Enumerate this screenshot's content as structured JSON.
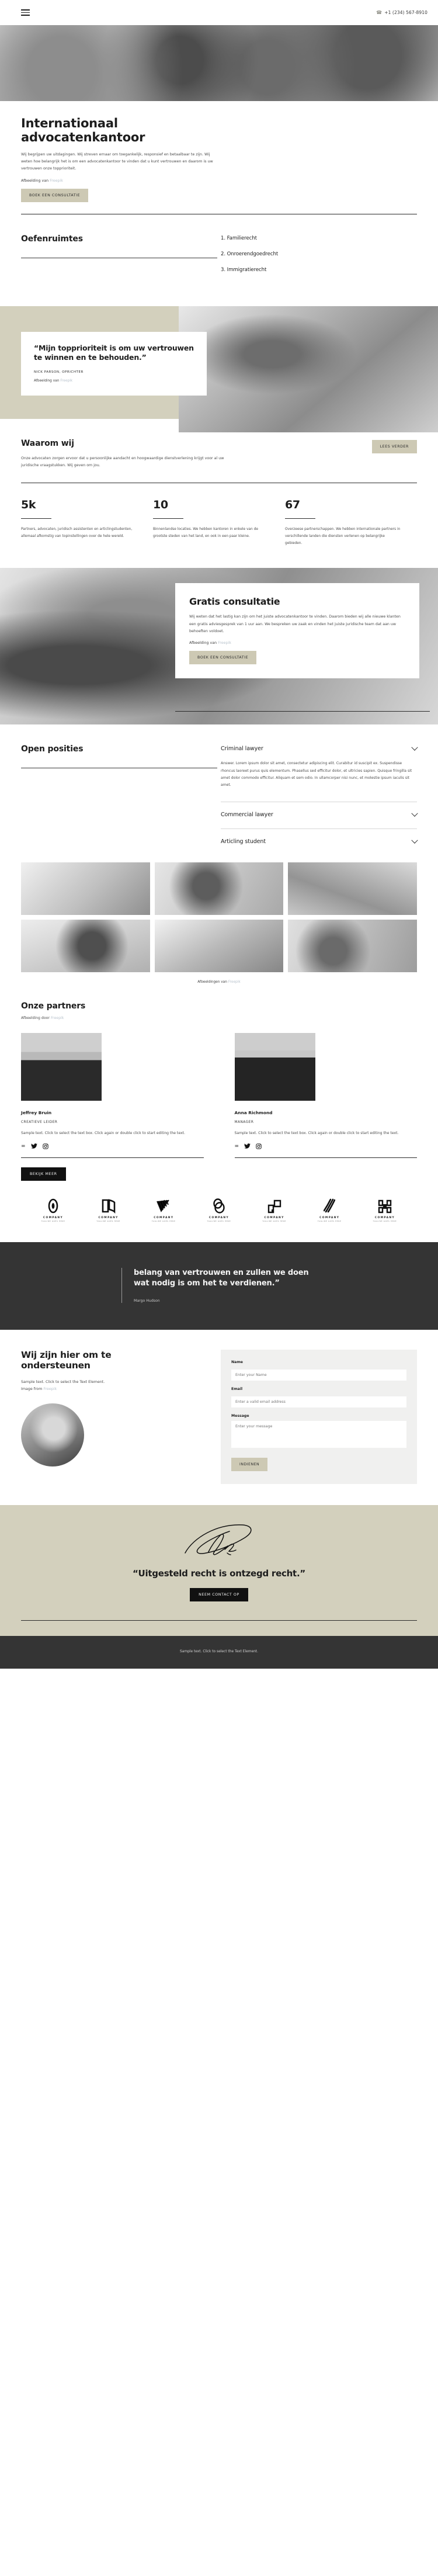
{
  "topbar": {
    "menu_icon": "hamburger-menu-icon",
    "phone_icon": "phone-icon",
    "phone": "+1 (234) 567-8910"
  },
  "hero": {
    "title_line1": "Internationaal",
    "title_line2": "advocatenkantoor",
    "paragraph": "Wij begrijpen uw uitdagingen. Wij streven ernaar om toegankelijk, responsief en betaalbaar te zijn. Wij weten hoe belangrijk het is om een advocatenkantoor te vinden dat u kunt vertrouwen en daarom is uw vertrouwen onze topprioriteit.",
    "credit_prefix": "Afbeelding van",
    "credit_link": "Freepik",
    "cta": "BOEK EEN CONSULTATIE"
  },
  "practice": {
    "title": "Oefenruimtes",
    "items": [
      "1. Familierecht",
      "2. Onroerendgoedrecht",
      "3. Immigratierecht"
    ]
  },
  "testimonial": {
    "quote": "“Mijn topprioriteit is om uw vertrouwen te winnen en te behouden.”",
    "author": "NICK PARSON, OPRICHTER",
    "credit_prefix": "Afbeelding van",
    "credit_link": "Freepik"
  },
  "why": {
    "title": "Waarom wij",
    "paragraph": "Onze advocaten zorgen ervoor dat u persoonlijke aandacht en hoogwaardige dienstverlening krijgt voor al uw juridische vraagstukken. Wij geven om jou.",
    "cta": "LEES VERDER",
    "stats": [
      {
        "number": "5k",
        "text": "Partners, advocaten, juridisch assistenten en articlingstudenten, allemaal afkomstig van topinstellingen over de hele wereld."
      },
      {
        "number": "10",
        "text": "Binnenlandse locaties. We hebben kantoren in enkele van de grootste steden van het land, en ook in een paar kleine."
      },
      {
        "number": "67",
        "text": "Overzeese partnerschappen. We hebben internationale partners in verschillende landen die diensten verlenen op belangrijke gebieden."
      }
    ]
  },
  "consult": {
    "title": "Gratis consultatie",
    "paragraph": "Wij weten dat het lastig kan zijn om het juiste advocatenkantoor te vinden. Daarom bieden wij alle nieuwe klanten een gratis adviesgesprek van 1 uur aan. We bespreken uw zaak en vinden het juiste juridische team dat aan uw behoeften voldoet.",
    "credit_prefix": "Afbeelding van",
    "credit_link": "Freepik",
    "cta": "BOEK EEN CONSULTATIE"
  },
  "positions": {
    "title": "Open posities",
    "accordion": [
      {
        "label": "Criminal lawyer",
        "body": "Answer. Lorem ipsum dolor sit amet, consectetur adipiscing elit. Curabitur id suscipit ex. Suspendisse rhoncus laoreet purus quis elementum. Phasellus sed efficitur dolor, et ultricies sapien. Quisque fringilla sit amet dolor commodo efficitur. Aliquam et sem odio. In ullamcorper nisi nunc, et molestie ipsum iaculis sit amet.",
        "expanded": true
      },
      {
        "label": "Commercial lawyer",
        "body": "",
        "expanded": false
      },
      {
        "label": "Articling student",
        "body": "",
        "expanded": false
      }
    ]
  },
  "gallery": {
    "credit_prefix": "Afbeeldingen van",
    "credit_link": "Freepik"
  },
  "partners": {
    "title": "Onze partners",
    "subtitle_prefix": "Afbeelding door",
    "subtitle_link": "Freepik",
    "people": [
      {
        "name": "Jeffrey Bruin",
        "role": "CREATIEVE LEIDER",
        "bio": "Sample text. Click to select the text box. Click again or double click to start editing the text.",
        "socials": [
          "facebook-icon",
          "twitter-icon",
          "instagram-icon"
        ]
      },
      {
        "name": "Anna Richmond",
        "role": "MANAGER",
        "bio": "Sample text. Click to select the text box. Click again or double click to start editing the text.",
        "socials": [
          "facebook-icon",
          "twitter-icon",
          "instagram-icon"
        ]
      }
    ],
    "cta": "BEKIJK MEER"
  },
  "logos": [
    {
      "name": "COMPANY",
      "tagline": "TAGLINE GOES HERE"
    },
    {
      "name": "COMPANY",
      "tagline": "TAGLINE GOES HERE"
    },
    {
      "name": "COMPANY",
      "tagline": "TAGLINE GOES HERE"
    },
    {
      "name": "COMPANY",
      "tagline": "TAGLINE GOES HERE"
    },
    {
      "name": "COMPANY",
      "tagline": "TAGLINE GOES HERE"
    },
    {
      "name": "COMPANY",
      "tagline": "TAGLINE GOES HERE"
    },
    {
      "name": "COMPANY",
      "tagline": "TAGLINE GOES HERE"
    }
  ],
  "dark_quote": {
    "quote": "belang van vertrouwen en zullen we doen wat nodig is om het te verdienen.”",
    "author": "Margo Hudson"
  },
  "contact": {
    "title_line1": "Wij zijn hier om te",
    "title_line2": "ondersteunen",
    "sub_line1": "Sample text. Click to select the Text Element.",
    "sub_line2_prefix": "Image from",
    "sub_line2_link": "Freepik",
    "form": {
      "name_label": "Name",
      "name_placeholder": "Enter your Name",
      "email_label": "Email",
      "email_placeholder": "Enter a valid email address",
      "message_label": "Message",
      "message_placeholder": "Enter your message",
      "submit": "INDIENEN"
    }
  },
  "cta_footer": {
    "signature_icon": "signature-icon",
    "quote": "“Uitgesteld recht is ontzegd recht.”",
    "button": "NEEM CONTACT OP"
  },
  "footer": {
    "text": "Sample text. Click to select the Text Element."
  },
  "colors": {
    "tan": "#cdc9b4",
    "band": "#d3d0bd",
    "dark": "#343434",
    "link": "#b9c3cd"
  }
}
